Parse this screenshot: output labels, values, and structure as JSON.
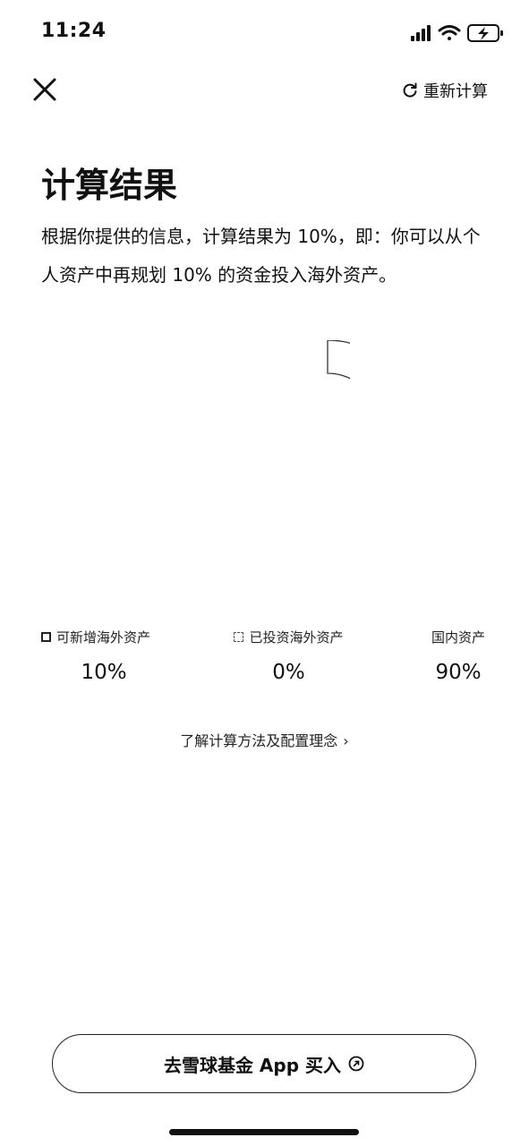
{
  "status_bar": {
    "time": "11:24"
  },
  "nav": {
    "recalculate_label": "重新计算",
    "close_icon": "close-icon",
    "refresh_icon": "refresh-icon"
  },
  "result": {
    "title": "计算结果",
    "description": "根据你提供的信息，计算结果为 10%，即：你可以从个人资产中再规划 10% 的资金投入海外资产。"
  },
  "chart_data": {
    "type": "pie",
    "slices": [
      {
        "name": "可新增海外资产",
        "value": 10
      },
      {
        "name": "已投资海外资产",
        "value": 0
      },
      {
        "name": "国内资产",
        "value": 90
      }
    ]
  },
  "legend": [
    {
      "label": "可新增海外资产",
      "value": "10%",
      "swatch": "solid-outline"
    },
    {
      "label": "已投资海外资产",
      "value": "0%",
      "swatch": "dashed-outline"
    },
    {
      "label": "国内资产",
      "value": "90%",
      "swatch": "none"
    }
  ],
  "method_link": {
    "label": "了解计算方法及配置理念",
    "icon": "chevron-right-icon"
  },
  "cta": {
    "label": "去雪球基金 App 买入",
    "icon": "external-link-icon"
  }
}
